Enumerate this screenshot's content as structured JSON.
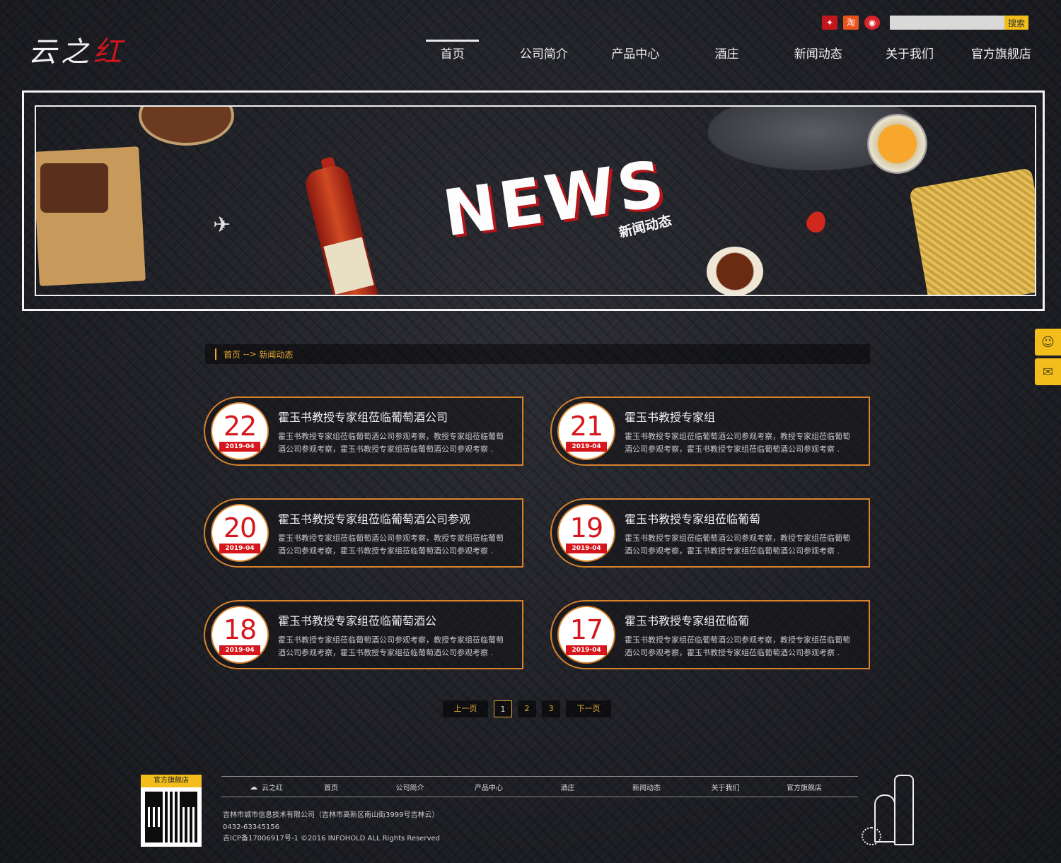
{
  "header": {
    "logo_text_main": "云之",
    "logo_text_red": "红",
    "icons": [
      "weibo-red-icon",
      "taobao-icon",
      "weibo-icon"
    ],
    "icon_glyphs": [
      "✦",
      "淘",
      "◉"
    ],
    "search": {
      "placeholder": "",
      "value": "",
      "button": "搜索"
    },
    "nav": [
      {
        "label": "首页",
        "active": true
      },
      {
        "label": "公司简介"
      },
      {
        "label": "产品中心"
      },
      {
        "label": "酒庄"
      },
      {
        "label": "新闻动态"
      },
      {
        "label": "关于我们"
      },
      {
        "label": "官方旗舰店"
      }
    ]
  },
  "banner": {
    "title": "NEWS",
    "subtitle": "新闻动态"
  },
  "breadcrumb": {
    "home": "首页",
    "separator": " --> ",
    "current": "新闻动态"
  },
  "news": [
    {
      "day": "22",
      "ym": "2019-04",
      "title": "霍玉书教授专家组莅临葡萄酒公司",
      "desc": "霍玉书教授专家组莅临葡萄酒公司参观考察，教授专家组莅临葡萄酒公司参观考察，霍玉书教授专家组莅临葡萄酒公司参观考察 ."
    },
    {
      "day": "21",
      "ym": "2019-04",
      "title": "霍玉书教授专家组",
      "desc": "霍玉书教授专家组莅临葡萄酒公司参观考察，教授专家组莅临葡萄酒公司参观考察，霍玉书教授专家组莅临葡萄酒公司参观考察 ."
    },
    {
      "day": "20",
      "ym": "2019-04",
      "title": "霍玉书教授专家组莅临葡萄酒公司参观",
      "desc": "霍玉书教授专家组莅临葡萄酒公司参观考察，教授专家组莅临葡萄酒公司参观考察，霍玉书教授专家组莅临葡萄酒公司参观考察 ."
    },
    {
      "day": "19",
      "ym": "2019-04",
      "title": "霍玉书教授专家组莅临葡萄",
      "desc": "霍玉书教授专家组莅临葡萄酒公司参观考察，教授专家组莅临葡萄酒公司参观考察，霍玉书教授专家组莅临葡萄酒公司参观考察 ."
    },
    {
      "day": "18",
      "ym": "2019-04",
      "title": "霍玉书教授专家组莅临葡萄酒公",
      "desc": "霍玉书教授专家组莅临葡萄酒公司参观考察，教授专家组莅临葡萄酒公司参观考察，霍玉书教授专家组莅临葡萄酒公司参观考察 ."
    },
    {
      "day": "17",
      "ym": "2019-04",
      "title": "霍玉书教授专家组莅临葡",
      "desc": "霍玉书教授专家组莅临葡萄酒公司参观考察，教授专家组莅临葡萄酒公司参观考察，霍玉书教授专家组莅临葡萄酒公司参观考察 ."
    }
  ],
  "pager": {
    "prev": "上一页",
    "pages": [
      "1",
      "2",
      "3"
    ],
    "current": "1",
    "next": "下一页"
  },
  "footer": {
    "qr_label": "官方旗舰店",
    "nav": [
      "云之红",
      "首页",
      "公司简介",
      "产品中心",
      "酒庄",
      "新闻动态",
      "关于我们",
      "官方旗舰店"
    ],
    "company": "吉林市城市信息技术有限公司（吉林市高新区南山街3999号吉林云）",
    "phone": "0432-63345156",
    "icp": "吉ICP备17006917号-1 ©2016 INFOHOLD ALL Rights Reserved"
  },
  "side_float": [
    "user-service-icon",
    "chat-icon"
  ],
  "side_float_glyphs": [
    "☺",
    "✉"
  ],
  "colors": {
    "accent_gold": "#f3bd1c",
    "accent_orange": "#d8822c",
    "date_red": "#d6161d"
  }
}
